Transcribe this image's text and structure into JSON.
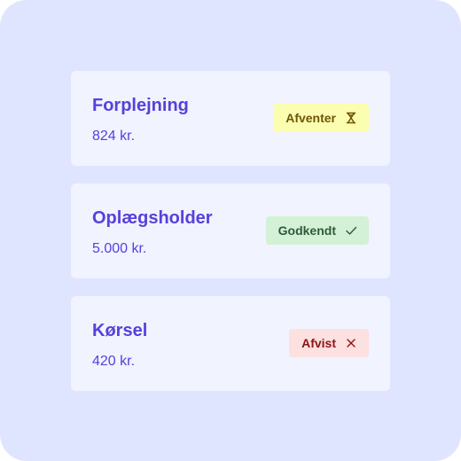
{
  "items": [
    {
      "title": "Forplejning",
      "amount": "824 kr.",
      "status": {
        "label": "Afventer",
        "icon": "hourglass-icon",
        "tone": "pending",
        "bg": "#fbfdb1",
        "fg": "#6e5706"
      }
    },
    {
      "title": "Oplægsholder",
      "amount": "5.000 kr.",
      "status": {
        "label": "Godkendt",
        "icon": "check-icon",
        "tone": "approved",
        "bg": "#d3f1d6",
        "fg": "#2f5a38"
      }
    },
    {
      "title": "Kørsel",
      "amount": "420 kr.",
      "status": {
        "label": "Afvist",
        "icon": "x-icon",
        "tone": "rejected",
        "bg": "#fde0e0",
        "fg": "#8e1414"
      }
    }
  ],
  "colors": {
    "background": "#e0e5ff",
    "card": "#f1f3ff",
    "accent": "#5840dc"
  }
}
